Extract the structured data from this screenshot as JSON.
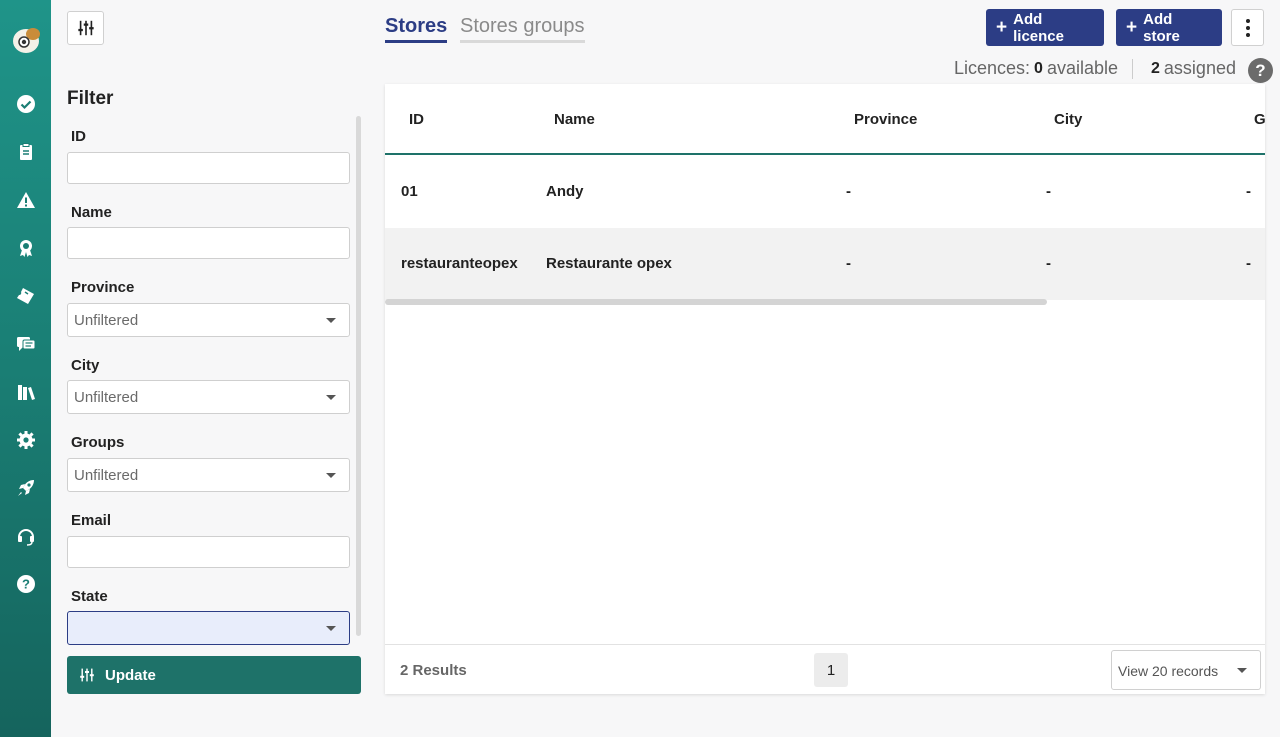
{
  "sidebar": {
    "items": [
      {
        "name": "check-circle-icon"
      },
      {
        "name": "clipboard-icon"
      },
      {
        "name": "warning-icon"
      },
      {
        "name": "award-icon"
      },
      {
        "name": "ticket-icon"
      },
      {
        "name": "chat-icon"
      },
      {
        "name": "books-icon"
      },
      {
        "name": "gear-icon"
      },
      {
        "name": "rocket-icon"
      },
      {
        "name": "headset-icon"
      },
      {
        "name": "help-icon"
      }
    ]
  },
  "filter": {
    "title": "Filter",
    "fields": {
      "id": {
        "label": "ID",
        "value": ""
      },
      "name": {
        "label": "Name",
        "value": ""
      },
      "province": {
        "label": "Province",
        "value": "Unfiltered"
      },
      "city": {
        "label": "City",
        "value": "Unfiltered"
      },
      "groups": {
        "label": "Groups",
        "value": "Unfiltered"
      },
      "email": {
        "label": "Email",
        "value": ""
      },
      "state": {
        "label": "State",
        "value": ""
      }
    },
    "update_label": "Update"
  },
  "tabs": [
    {
      "label": "Stores",
      "active": true
    },
    {
      "label": "Stores groups",
      "active": false
    }
  ],
  "toolbar": {
    "add_licence": "Add licence",
    "add_store": "Add store"
  },
  "licences": {
    "label": "Licences:",
    "available_count": "0",
    "available_label": "available",
    "assigned_count": "2",
    "assigned_label": "assigned",
    "help": "?"
  },
  "table": {
    "columns": [
      "ID",
      "Name",
      "Province",
      "City",
      "G"
    ],
    "rows": [
      {
        "id": "01",
        "name": "Andy",
        "province": "-",
        "city": "-",
        "g": "-"
      },
      {
        "id": "restauranteopex",
        "name": "Restaurante opex",
        "province": "-",
        "city": "-",
        "g": "-"
      }
    ]
  },
  "footer": {
    "results": "2 Results",
    "page": "1",
    "records": "View 20 records"
  },
  "colors": {
    "brand": "#2c3d85",
    "teal": "#1e7269"
  }
}
